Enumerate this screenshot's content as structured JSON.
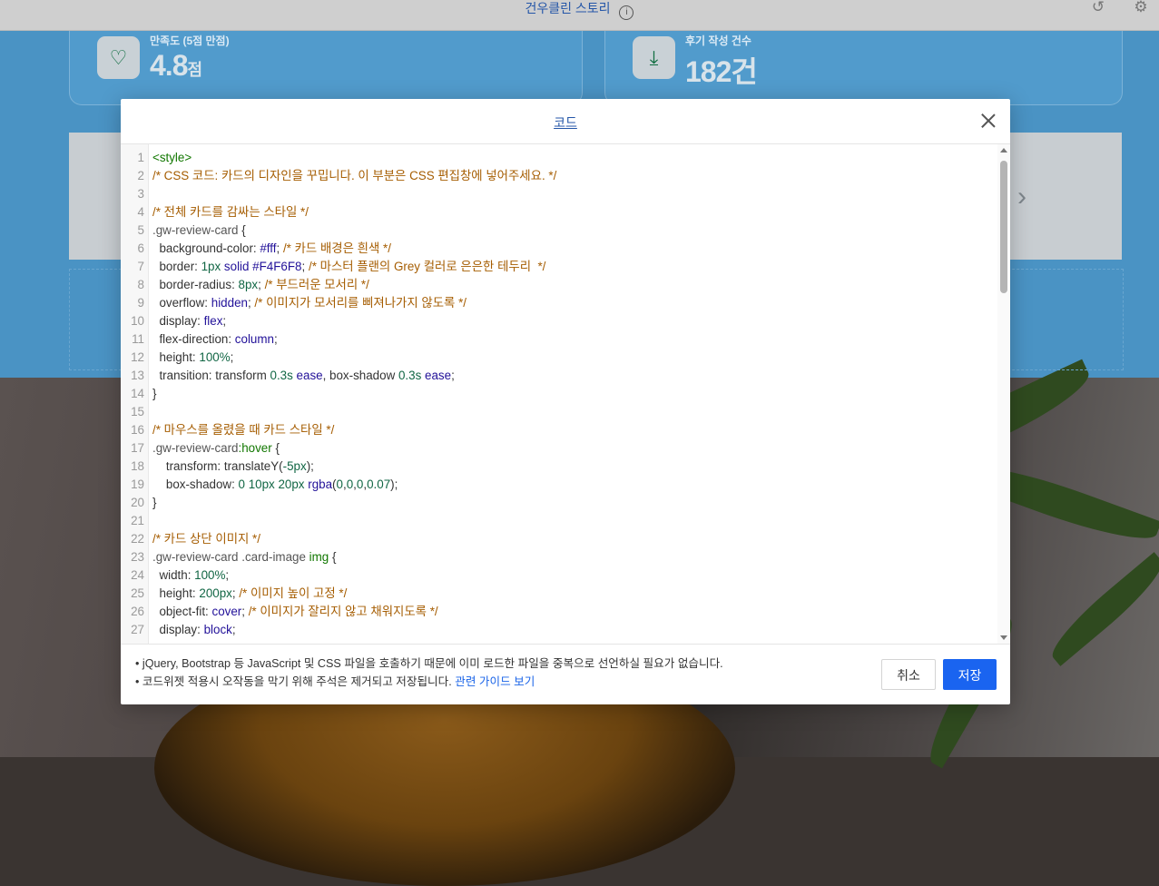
{
  "page": {
    "header_title": "건우클린 스토리",
    "stats": [
      {
        "label": "만족도 (5점 만점)",
        "value": "4.8",
        "unit": "점",
        "icon": "heart-icon"
      },
      {
        "label": "후기 작성 건수",
        "value": "182건",
        "icon": "download-icon"
      }
    ]
  },
  "modal": {
    "title": "코드",
    "code_lines": [
      [
        {
          "t": "tag",
          "s": "<style>"
        }
      ],
      [
        {
          "t": "cm",
          "s": "/* CSS 코드: 카드의 디자인을 꾸밉니다. 이 부분은 CSS 편집창에 넣어주세요. */"
        }
      ],
      [],
      [
        {
          "t": "cm",
          "s": "/* 전체 카드를 감싸는 스타일 */"
        }
      ],
      [
        {
          "t": "sel",
          "s": ".gw-review-card"
        },
        {
          "t": "prop",
          "s": " {"
        }
      ],
      [
        {
          "t": "prop",
          "s": "  background-color: "
        },
        {
          "t": "kw",
          "s": "#fff"
        },
        {
          "t": "prop",
          "s": "; "
        },
        {
          "t": "cm",
          "s": "/* 카드 배경은 흰색 */"
        }
      ],
      [
        {
          "t": "prop",
          "s": "  border: "
        },
        {
          "t": "num",
          "s": "1px"
        },
        {
          "t": "prop",
          "s": " "
        },
        {
          "t": "kw",
          "s": "solid #F4F6F8"
        },
        {
          "t": "prop",
          "s": "; "
        },
        {
          "t": "cm",
          "s": "/* 마스터 플랜의 Grey 컬러로 은은한 테두리  */"
        }
      ],
      [
        {
          "t": "prop",
          "s": "  border-radius: "
        },
        {
          "t": "num",
          "s": "8px"
        },
        {
          "t": "prop",
          "s": "; "
        },
        {
          "t": "cm",
          "s": "/* 부드러운 모서리 */"
        }
      ],
      [
        {
          "t": "prop",
          "s": "  overflow: "
        },
        {
          "t": "kw",
          "s": "hidden"
        },
        {
          "t": "prop",
          "s": "; "
        },
        {
          "t": "cm",
          "s": "/* 이미지가 모서리를 삐져나가지 않도록 */"
        }
      ],
      [
        {
          "t": "prop",
          "s": "  display: "
        },
        {
          "t": "kw",
          "s": "flex"
        },
        {
          "t": "prop",
          "s": ";"
        }
      ],
      [
        {
          "t": "prop",
          "s": "  flex-direction: "
        },
        {
          "t": "kw",
          "s": "column"
        },
        {
          "t": "prop",
          "s": ";"
        }
      ],
      [
        {
          "t": "prop",
          "s": "  height: "
        },
        {
          "t": "num",
          "s": "100%"
        },
        {
          "t": "prop",
          "s": ";"
        }
      ],
      [
        {
          "t": "prop",
          "s": "  transition: transform "
        },
        {
          "t": "num",
          "s": "0.3s"
        },
        {
          "t": "prop",
          "s": " "
        },
        {
          "t": "kw",
          "s": "ease"
        },
        {
          "t": "prop",
          "s": ", box-shadow "
        },
        {
          "t": "num",
          "s": "0.3s"
        },
        {
          "t": "prop",
          "s": " "
        },
        {
          "t": "kw",
          "s": "ease"
        },
        {
          "t": "prop",
          "s": ";"
        }
      ],
      [
        {
          "t": "prop",
          "s": "}"
        }
      ],
      [],
      [
        {
          "t": "cm",
          "s": "/* 마우스를 올렸을 때 카드 스타일 */"
        }
      ],
      [
        {
          "t": "sel",
          "s": ".gw-review-card"
        },
        {
          "t": "ps",
          "s": ":hover"
        },
        {
          "t": "prop",
          "s": " {"
        }
      ],
      [
        {
          "t": "prop",
          "s": "    transform: translateY("
        },
        {
          "t": "num",
          "s": "-5px"
        },
        {
          "t": "prop",
          "s": ");"
        }
      ],
      [
        {
          "t": "prop",
          "s": "    box-shadow: "
        },
        {
          "t": "num",
          "s": "0 10px 20px"
        },
        {
          "t": "prop",
          "s": " "
        },
        {
          "t": "kw",
          "s": "rgba"
        },
        {
          "t": "prop",
          "s": "("
        },
        {
          "t": "num",
          "s": "0"
        },
        {
          "t": "prop",
          "s": ","
        },
        {
          "t": "num",
          "s": "0"
        },
        {
          "t": "prop",
          "s": ","
        },
        {
          "t": "num",
          "s": "0"
        },
        {
          "t": "prop",
          "s": ","
        },
        {
          "t": "num",
          "s": "0.07"
        },
        {
          "t": "prop",
          "s": ");"
        }
      ],
      [
        {
          "t": "prop",
          "s": "}"
        }
      ],
      [],
      [
        {
          "t": "cm",
          "s": "/* 카드 상단 이미지 */"
        }
      ],
      [
        {
          "t": "sel",
          "s": ".gw-review-card .card-image"
        },
        {
          "t": "prop",
          "s": " "
        },
        {
          "t": "tag",
          "s": "img"
        },
        {
          "t": "prop",
          "s": " {"
        }
      ],
      [
        {
          "t": "prop",
          "s": "  width: "
        },
        {
          "t": "num",
          "s": "100%"
        },
        {
          "t": "prop",
          "s": ";"
        }
      ],
      [
        {
          "t": "prop",
          "s": "  height: "
        },
        {
          "t": "num",
          "s": "200px"
        },
        {
          "t": "prop",
          "s": "; "
        },
        {
          "t": "cm",
          "s": "/* 이미지 높이 고정 */"
        }
      ],
      [
        {
          "t": "prop",
          "s": "  object-fit: "
        },
        {
          "t": "kw",
          "s": "cover"
        },
        {
          "t": "prop",
          "s": "; "
        },
        {
          "t": "cm",
          "s": "/* 이미지가 잘리지 않고 채워지도록 */"
        }
      ],
      [
        {
          "t": "prop",
          "s": "  display: "
        },
        {
          "t": "kw",
          "s": "block"
        },
        {
          "t": "prop",
          "s": ";"
        }
      ]
    ],
    "note_1": "• jQuery, Bootstrap 등 JavaScript 및 CSS 파일을 호출하기 때문에 이미 로드한 파일을 중복으로 선언하실 필요가 없습니다.",
    "note_2_prefix": "• 코드위젯 적용시 오작동을 막기 위해 주석은 제거되고 저장됩니다. ",
    "guide_link": "관련 가이드 보기",
    "cancel_label": "취소",
    "save_label": "저장"
  },
  "colors": {
    "accent": "#1a64f0",
    "link": "#1a64e8",
    "title": "#2456a8",
    "comment": "#a55c00",
    "tag": "#117700",
    "number": "#116644",
    "keyword": "#221199"
  }
}
